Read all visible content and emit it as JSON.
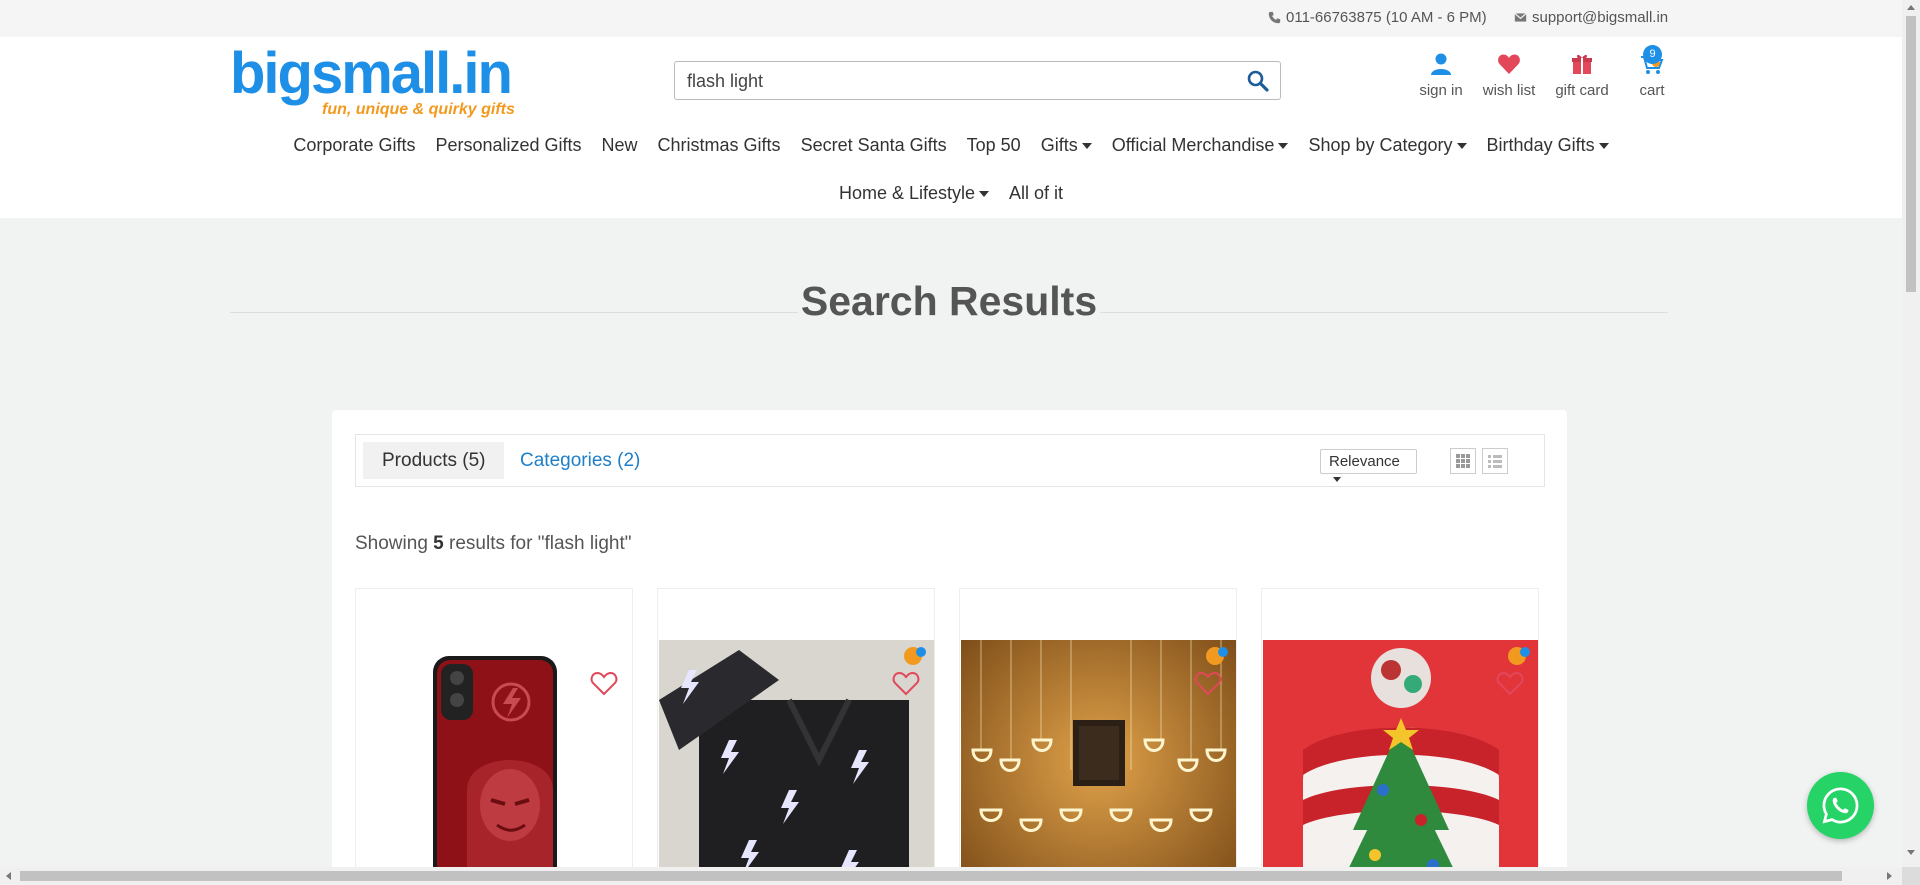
{
  "topbar": {
    "phone": "011-66763875 (10 AM - 6 PM)",
    "email": "support@bigsmall.in"
  },
  "header": {
    "logo_text": "bigsmall.in",
    "logo_tagline": "fun, unique & quirky gifts",
    "search_value": "flash light",
    "icons": {
      "signin": "sign in",
      "wishlist": "wish list",
      "giftcard": "gift card",
      "cart": "cart",
      "cart_count": "9"
    }
  },
  "nav": {
    "row1": [
      {
        "label": "Corporate Gifts",
        "dropdown": false
      },
      {
        "label": "Personalized Gifts",
        "dropdown": false
      },
      {
        "label": "New",
        "dropdown": false
      },
      {
        "label": "Christmas Gifts",
        "dropdown": false
      },
      {
        "label": "Secret Santa Gifts",
        "dropdown": false
      },
      {
        "label": "Top 50",
        "dropdown": false
      },
      {
        "label": "Gifts",
        "dropdown": true
      },
      {
        "label": "Official Merchandise",
        "dropdown": true
      },
      {
        "label": "Shop by Category",
        "dropdown": true
      },
      {
        "label": "Birthday Gifts",
        "dropdown": true
      }
    ],
    "row2": [
      {
        "label": "Home & Lifestyle",
        "dropdown": true
      },
      {
        "label": "All of it",
        "dropdown": false
      }
    ]
  },
  "page": {
    "title": "Search Results"
  },
  "results": {
    "tabs": {
      "products": "Products (5)",
      "categories": "Categories (2)"
    },
    "sort_label": "Relevance",
    "showing_prefix": "Showing ",
    "count": "5",
    "showing_suffix": " results for \"flash light\""
  },
  "products": [
    {
      "image": "phone-case-flash-red-icon"
    },
    {
      "image": "lightning-wrapping-paper-icon"
    },
    {
      "image": "diya-curtain-lights-icon"
    },
    {
      "image": "christmas-tree-beanie-icon"
    }
  ],
  "colors": {
    "brand_blue": "#1e8fe6",
    "brand_orange": "#f29a1f",
    "heart_red": "#e2475a",
    "whatsapp": "#25d366"
  }
}
